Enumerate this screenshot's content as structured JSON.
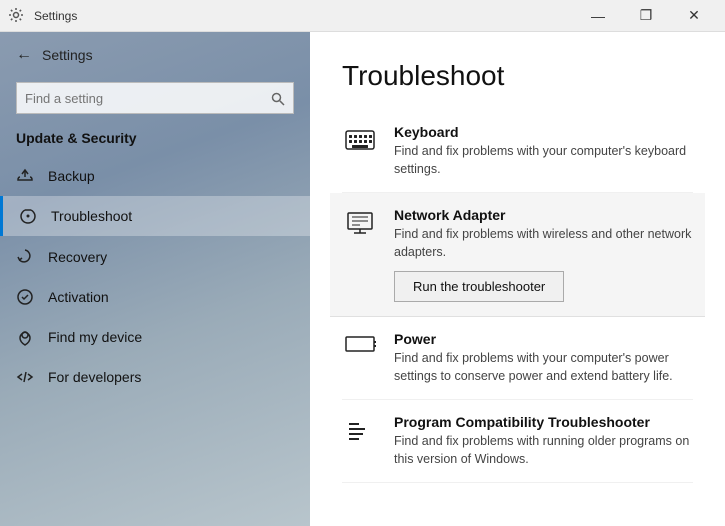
{
  "titleBar": {
    "title": "Settings",
    "minLabel": "—",
    "maxLabel": "❐",
    "closeLabel": "✕"
  },
  "sidebar": {
    "backLabel": "Settings",
    "search": {
      "placeholder": "Find a setting",
      "value": ""
    },
    "sectionTitle": "Update & Security",
    "items": [
      {
        "id": "backup",
        "label": "Backup",
        "icon": "backup"
      },
      {
        "id": "troubleshoot",
        "label": "Troubleshoot",
        "icon": "troubleshoot",
        "active": true
      },
      {
        "id": "recovery",
        "label": "Recovery",
        "icon": "recovery"
      },
      {
        "id": "activation",
        "label": "Activation",
        "icon": "activation"
      },
      {
        "id": "find-my-device",
        "label": "Find my device",
        "icon": "find-device"
      },
      {
        "id": "for-developers",
        "label": "For developers",
        "icon": "developers"
      }
    ]
  },
  "content": {
    "title": "Troubleshoot",
    "items": [
      {
        "id": "keyboard",
        "name": "Keyboard",
        "desc": "Find and fix problems with your computer's keyboard settings.",
        "highlighted": false,
        "showButton": false
      },
      {
        "id": "network-adapter",
        "name": "Network Adapter",
        "desc": "Find and fix problems with wireless and other network adapters.",
        "highlighted": true,
        "showButton": true,
        "buttonLabel": "Run the troubleshooter"
      },
      {
        "id": "power",
        "name": "Power",
        "desc": "Find and fix problems with your computer's power settings to conserve power and extend battery life.",
        "highlighted": false,
        "showButton": false
      },
      {
        "id": "program-compatibility",
        "name": "Program Compatibility Troubleshooter",
        "desc": "Find and fix problems with running older programs on this version of Windows.",
        "highlighted": false,
        "showButton": false
      }
    ]
  }
}
